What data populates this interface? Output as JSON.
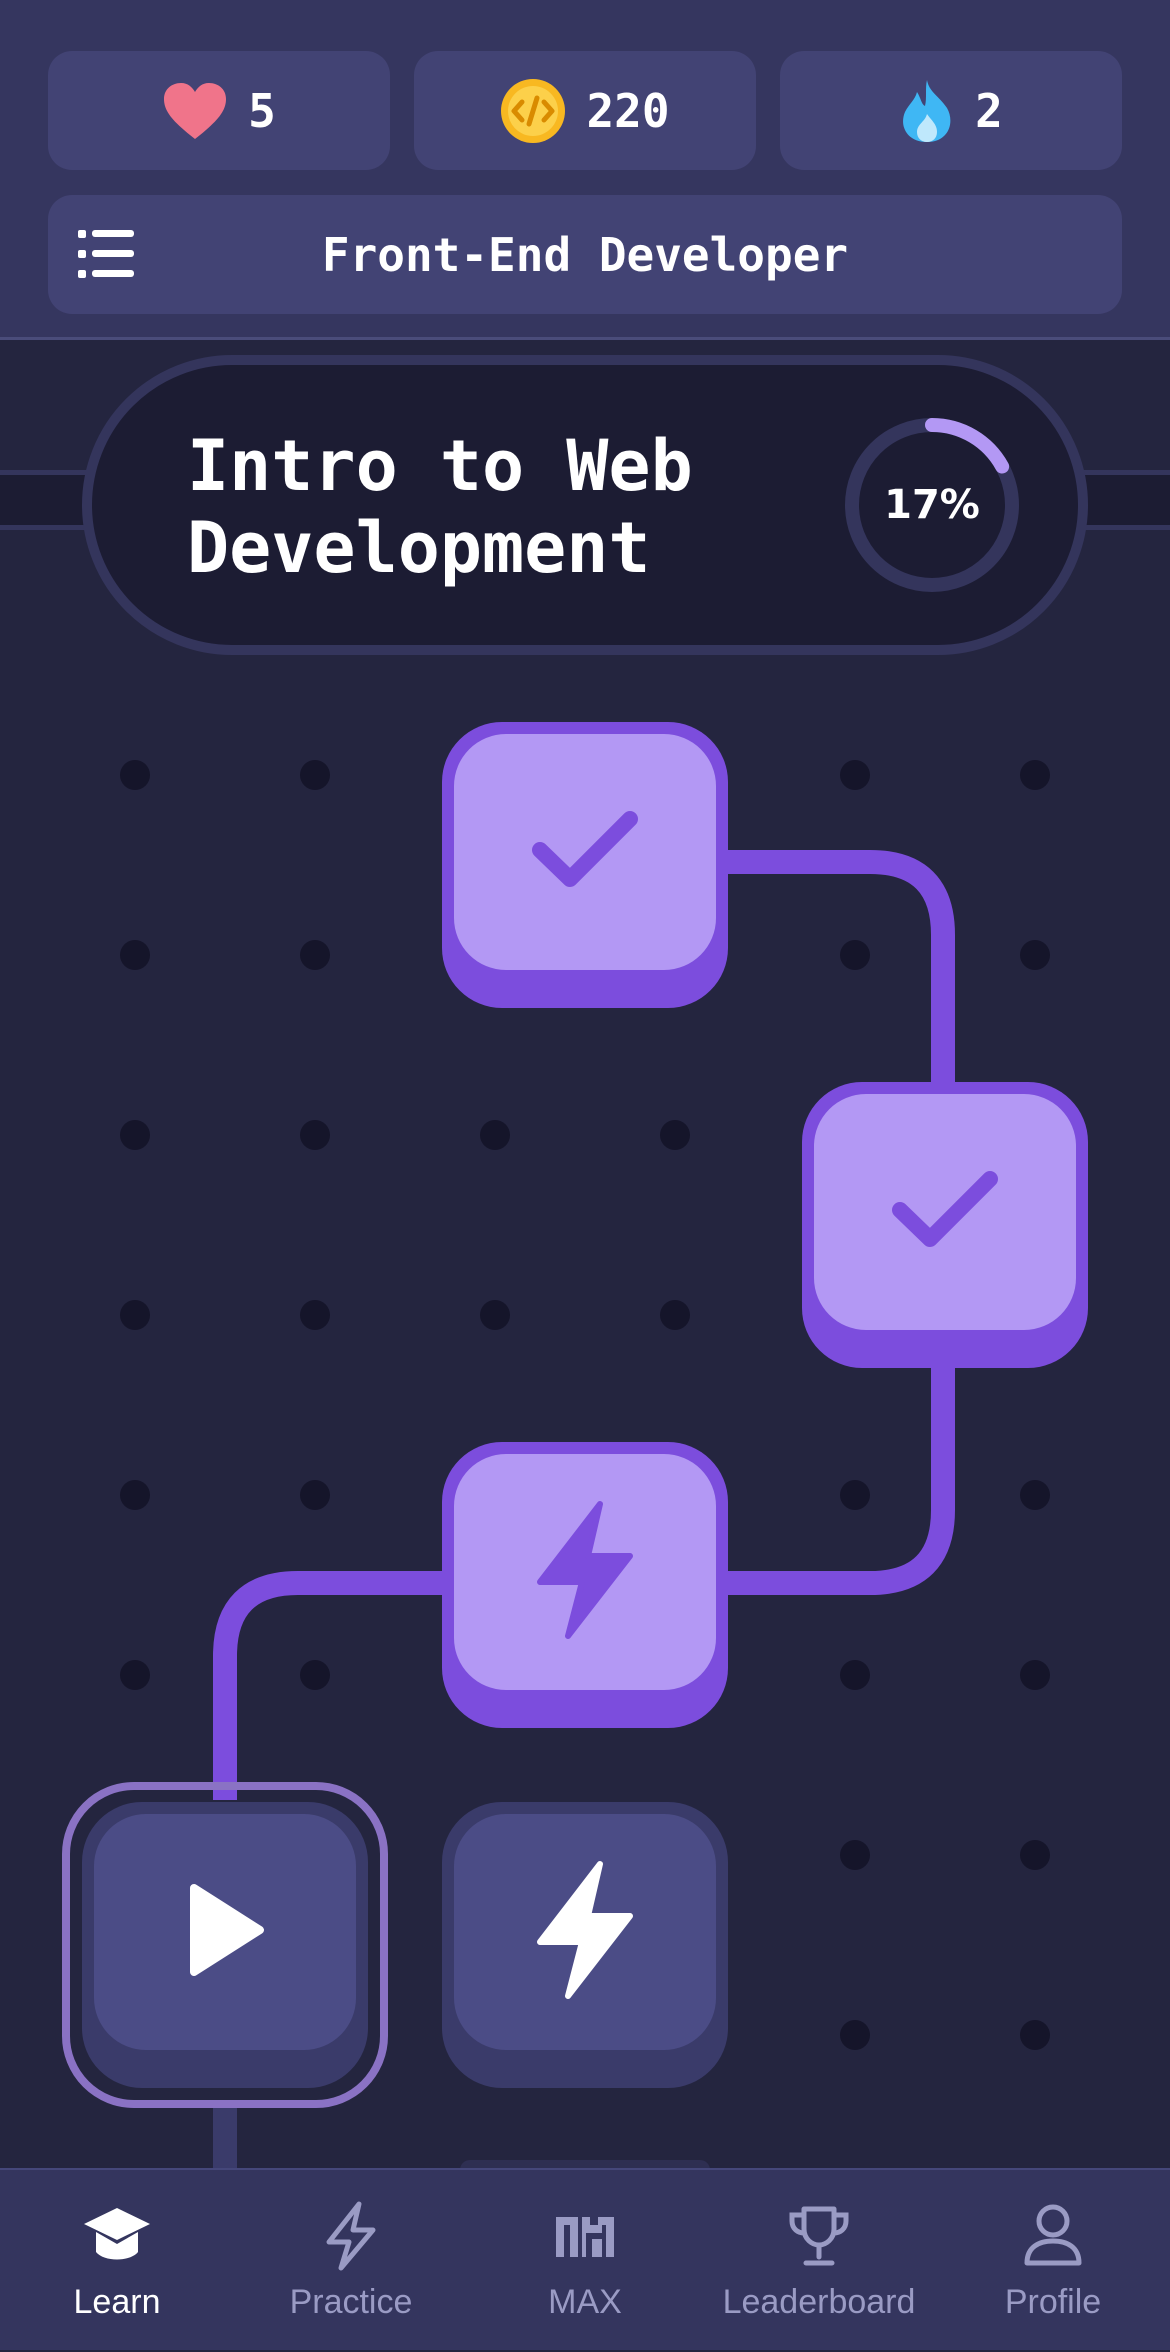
{
  "stats": {
    "hearts": {
      "value": "5",
      "icon": "heart-icon",
      "color": "#f0748a"
    },
    "coins": {
      "value": "220",
      "icon": "coin-icon",
      "color": "#f8b821"
    },
    "streak": {
      "value": "2",
      "icon": "flame-icon",
      "color": "#3fb7f4"
    }
  },
  "course": {
    "title": "Front-End Developer",
    "menu_icon": "list-icon"
  },
  "unit": {
    "title_line1": "Intro to Web",
    "title_line2": "Development",
    "progress": 0.17,
    "progress_label": "17%"
  },
  "lessons": [
    {
      "state": "completed",
      "icon": "check-icon"
    },
    {
      "state": "completed",
      "icon": "check-icon"
    },
    {
      "state": "completed",
      "icon": "lightning-icon"
    },
    {
      "state": "current",
      "icon": "play-icon"
    },
    {
      "state": "locked",
      "icon": "lightning-icon"
    }
  ],
  "nav": {
    "items": [
      {
        "label": "Learn",
        "icon": "graduation-cap-icon",
        "active": true
      },
      {
        "label": "Practice",
        "icon": "lightning-icon",
        "active": false
      },
      {
        "label": "MAX",
        "icon": "max-icon",
        "active": false
      },
      {
        "label": "Leaderboard",
        "icon": "trophy-icon",
        "active": false
      },
      {
        "label": "Profile",
        "icon": "user-icon",
        "active": false
      }
    ]
  },
  "colors": {
    "accent": "#7c4ddd",
    "accent_light": "#b398f4",
    "background": "#24253f",
    "header": "#35365f"
  }
}
